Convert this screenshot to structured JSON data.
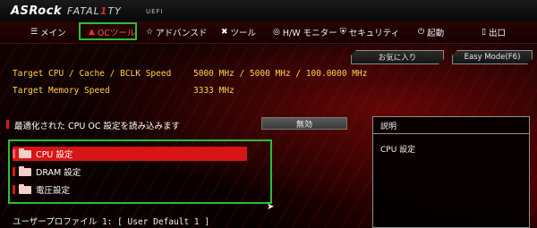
{
  "header": {
    "brand": "ASRock",
    "product_prefix": "FATAL",
    "product_mid": "1",
    "product_suffix": "TY",
    "uefi": "UEFI"
  },
  "tabs": [
    {
      "label": "メイン",
      "icon": "list-icon",
      "active": false
    },
    {
      "label": "OCツール",
      "icon": "flame-icon",
      "active": true
    },
    {
      "label": "アドバンスド",
      "icon": "star-icon",
      "active": false
    },
    {
      "label": "ツール",
      "icon": "tools-icon",
      "active": false
    },
    {
      "label": "H/W モニター",
      "icon": "monitor-icon",
      "active": false
    },
    {
      "label": "セキュリティ",
      "icon": "shield-icon",
      "active": false
    },
    {
      "label": "起動",
      "icon": "power-icon",
      "active": false
    },
    {
      "label": "出口",
      "icon": "exit-icon",
      "active": false
    }
  ],
  "buttons": {
    "favorites": "お気に入り",
    "easy_mode": "Easy Mode(F6)"
  },
  "info": {
    "cpu_label": "Target CPU / Cache / BCLK Speed",
    "cpu_value": "5000 MHz / 5000 MHz / 100.0000 MHz",
    "mem_label": "Target Memory Speed",
    "mem_value": "3333 MHz"
  },
  "optimized": {
    "label": "最適化された CPU OC 設定を読み込みます",
    "value": "無効"
  },
  "menu": [
    {
      "label": "CPU 設定",
      "selected": true
    },
    {
      "label": "DRAM 設定",
      "selected": false
    },
    {
      "label": "電圧設定",
      "selected": false
    }
  ],
  "profile": "ユーザープロファイル 1: [ User Default 1 ]",
  "description": {
    "title": "説明",
    "text": "CPU 設定"
  },
  "colors": {
    "accent_red": "#d81414",
    "info_yellow": "#ffd24a",
    "highlight_green": "#2fbd2f"
  }
}
